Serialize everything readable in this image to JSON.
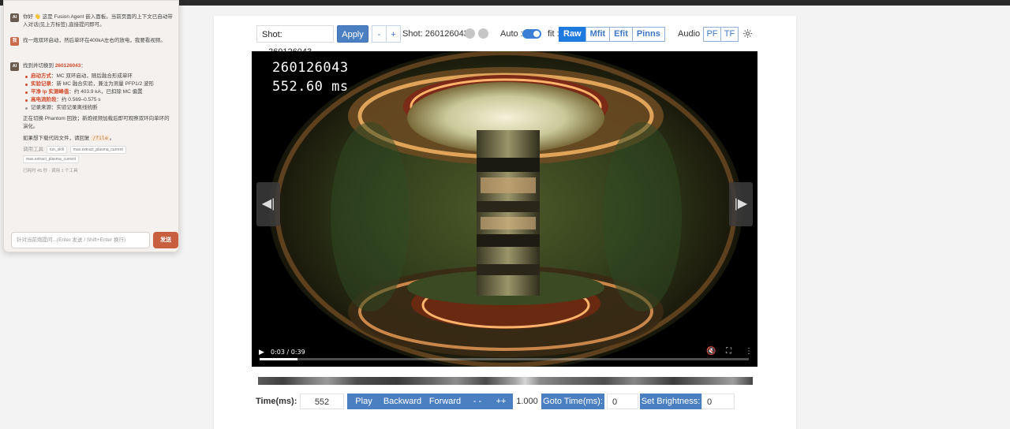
{
  "controls": {
    "shot_label": "Shot:",
    "shot_value": "260126043",
    "apply_label": "Apply",
    "minus_label": "-",
    "plus_label": "+",
    "shot_display": "Shot: 260126043",
    "auto_label": "Auto :",
    "auto_on": true,
    "fit_label": "fit :",
    "fit_options": [
      "Raw",
      "Mfit",
      "Efit",
      "Pinns"
    ],
    "fit_selected": "Raw",
    "audio_label": "Audio :",
    "audio_options": [
      "PF",
      "TF"
    ],
    "settings_icon": "gear-icon"
  },
  "video": {
    "overlay_shot": "260126043",
    "overlay_time": "552.60 ms",
    "time_display": "0:03 / 0:39",
    "progress_fraction": 0.077,
    "prev_icon": "prev-frame-icon",
    "next_icon": "next-frame-icon"
  },
  "playback": {
    "time_label": "Time(ms):",
    "time_value": "552",
    "play_label": "Play",
    "backward_label": "Backward",
    "forward_label": "Forward",
    "slower_label": "- -",
    "faster_label": "++",
    "speed_value": "1.000",
    "goto_label": "Goto Time(ms):",
    "goto_value": "0",
    "brightness_label": "Set Brightness:",
    "brightness_value": "0"
  },
  "chat": {
    "ai_badge": "AI",
    "user_badge": "我",
    "msg1": "你好 👋 这是 Fusion Agent 嵌入面板。当前页面的上下文已自动带入对话(见上方标签),直接提问即可。",
    "msg2": "找一炮双环启动，然后单环在400kA左右的放电，我要看视频。",
    "msg3_prefix": "找到并切换到 ",
    "msg3_shot": "260126043",
    "msg3_suffix": "：",
    "bullets": [
      {
        "key": "启动方式",
        "value": "MC 双环启动，随后融合形成单环"
      },
      {
        "key": "实验记录",
        "value": "新 MC 融合实验，兼注为测量 PFP1/2 波形"
      },
      {
        "key": "平净 Ip 实测峰值",
        "value": "约 403.9 kA，已扣除 MC 偏置"
      },
      {
        "key": "高电流阶段",
        "value": "约 0.569–0.575 s"
      },
      {
        "key": "",
        "value": "记录来源：实验记录离线统断"
      }
    ],
    "para1": "正在切换 Phantom 回放；新炮视频加载后即可观察双环向单环的演化。",
    "para2_prefix": "如果想下载代码文件，请回复 ",
    "para2_code": "/file",
    "para2_suffix": "。",
    "tools_prefix": "调用工具:",
    "tools": [
      "run_skill",
      "mas.extract_plasma_current",
      "mas.extract_plasma_current"
    ],
    "footer": "已耗时 45 秒 · 调用 1 个工具",
    "input_placeholder": "针对当前炮提问...(Enter 发送 / Shift+Enter 换行)",
    "send_label": "发送"
  }
}
